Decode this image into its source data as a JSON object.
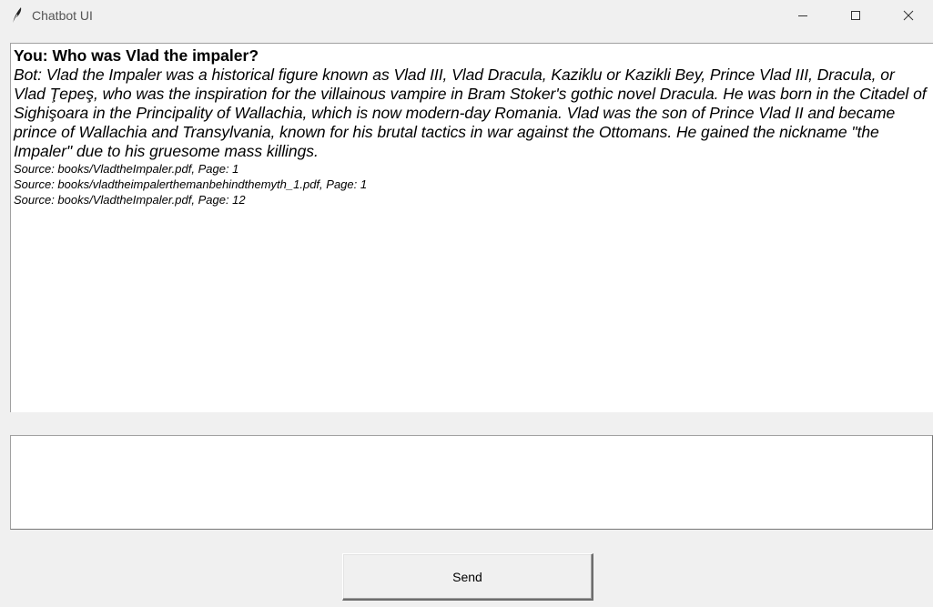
{
  "window": {
    "title": "Chatbot UI",
    "icon": "feather-icon",
    "controls": [
      "minimize-icon",
      "maximize-icon",
      "close-icon"
    ]
  },
  "chat": {
    "user_message": "You: Who was Vlad the impaler?",
    "bot_message": "Bot: Vlad the Impaler was a historical figure known as Vlad III, Vlad Dracula, Kaziklu or Kazikli Bey, Prince Vlad III, Dracula, or Vlad Ţepeş, who was the inspiration for the villainous vampire in Bram Stoker's gothic novel Dracula. He was born in the Citadel of Sighişoara in the Principality of Wallachia, which is now modern-day Romania. Vlad was the son of Prince Vlad II and became prince of Wallachia and Transylvania, known for his brutal tactics in war against the Ottomans. He gained the nickname \"the Impaler\" due to his gruesome mass killings.",
    "sources": [
      "Source: books/VladtheImpaler.pdf, Page: 1",
      "Source: books/vladtheimpalerthemanbehindthemyth_1.pdf, Page: 1",
      "Source: books/VladtheImpaler.pdf, Page: 12"
    ]
  },
  "input": {
    "value": ""
  },
  "send_button": {
    "label": "Send"
  }
}
